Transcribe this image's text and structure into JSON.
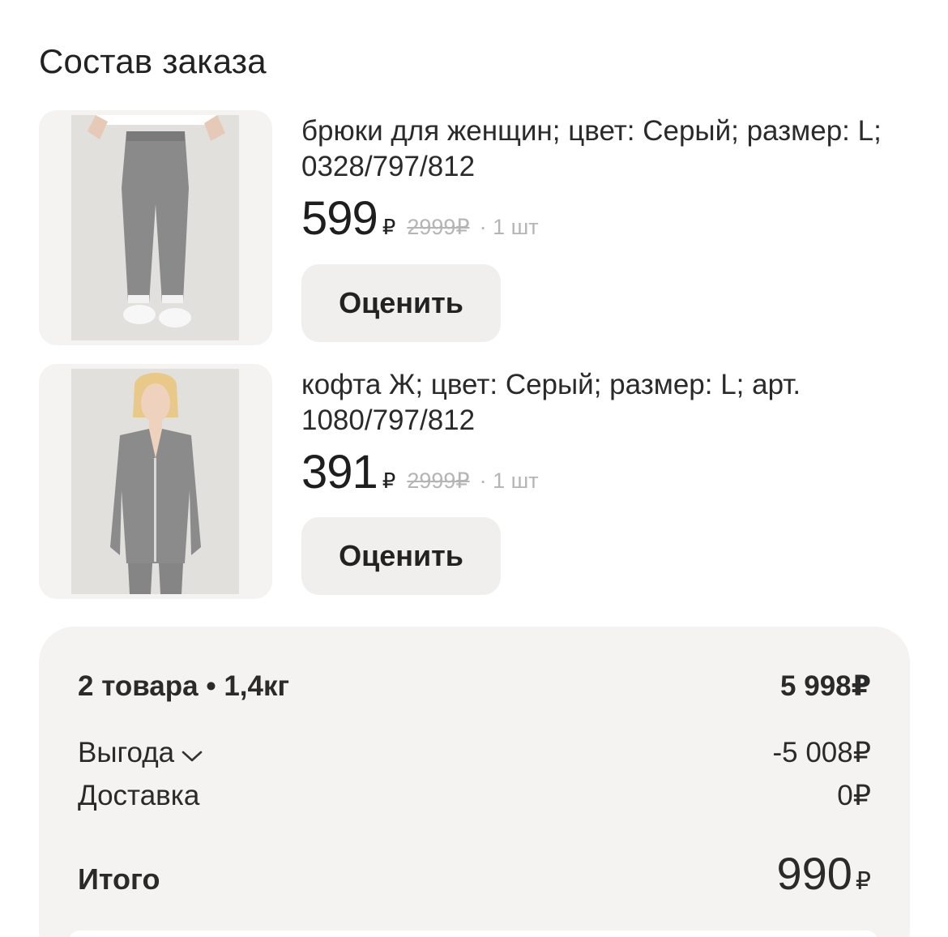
{
  "order": {
    "title": "Состав заказа",
    "items": [
      {
        "title": "брюки для женщин; цвет: Серый; размер: L; 0328/797/812",
        "price": "599",
        "currency": "₽",
        "old_price": "2999₽",
        "quantity": "· 1 шт",
        "rate_label": "Оценить",
        "image": "pants-photo"
      },
      {
        "title": "кофта Ж; цвет: Серый; размер: L; арт. 1080/797/812",
        "price": "391",
        "currency": "₽",
        "old_price": "2999₽",
        "quantity": "· 1 шт",
        "rate_label": "Оценить",
        "image": "top-photo"
      }
    ]
  },
  "summary": {
    "goods_label": "2 товара • 1,4кг",
    "goods_value": "5 998₽",
    "benefit_label": "Выгода",
    "benefit_value": "-5 008₽",
    "delivery_label": "Доставка",
    "delivery_value": "0₽",
    "total_label": "Итого",
    "total_value": "990",
    "total_currency": "₽"
  },
  "colors": {
    "card_bg": "#f4f3f1",
    "button_bg": "#f0efed",
    "muted_text": "#b5b5b5"
  }
}
